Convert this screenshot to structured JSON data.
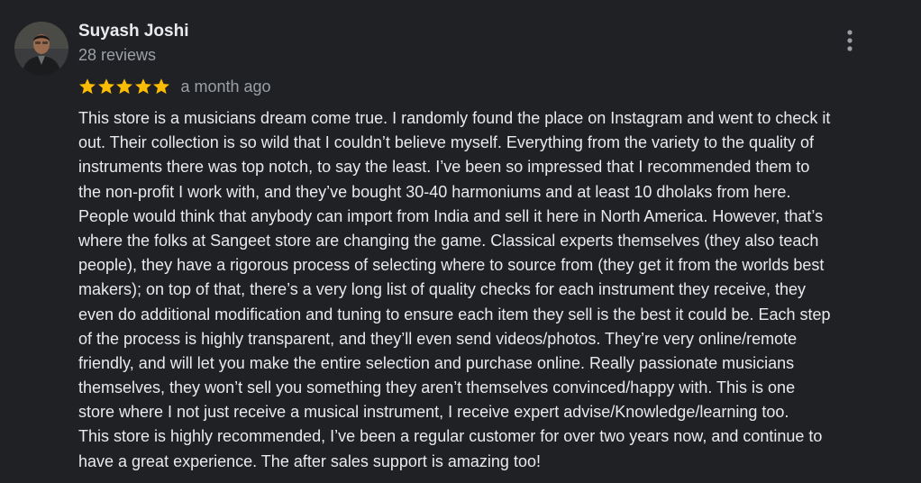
{
  "review": {
    "author": {
      "name": "Suyash Joshi",
      "review_count": "28 reviews",
      "avatar_icon": "user-profile-photo"
    },
    "rating": {
      "stars": 5,
      "max": 5,
      "star_color": "#fbbc04"
    },
    "date": "a month ago",
    "more_icon": "more-vert-icon",
    "text_lines": [
      "This store is a musicians dream come true. I randomly found the place on Instagram and went to check it",
      "out. Their collection is so wild that I couldn’t believe myself. Everything from the variety to the quality of",
      "instruments there was top notch, to say the least. I’ve been so impressed that I recommended them to",
      "the non-profit I work with, and they’ve bought 30-40 harmoniums and at least 10 dholaks from here.",
      "People would think that anybody can import from India and sell it here in North America. However, that’s",
      "where the folks at Sangeet store are changing the game. Classical experts themselves (they also teach",
      "people), they have a rigorous process of selecting where to source from (they get it from the worlds best",
      "makers); on top of that, there’s a very long list of quality checks for each instrument they receive, they",
      "even do additional modification and tuning to ensure each item they sell is the best it could be. Each step",
      "of the process is highly transparent, and they’ll even send videos/photos. They’re very online/remote",
      "friendly, and will let you make the entire selection and purchase online. Really passionate musicians",
      "themselves, they won’t sell you something they aren’t themselves convinced/happy with. This is one",
      "store where I not just receive a musical instrument, I receive expert advise/Knowledge/learning too.",
      "This store is highly recommended, I’ve been a regular customer for over two years now, and continue to",
      "have a great experience. The after sales support is amazing too!"
    ]
  },
  "colors": {
    "background": "#202124",
    "primary_text": "#e8eaed",
    "secondary_text": "#9aa0a6"
  }
}
